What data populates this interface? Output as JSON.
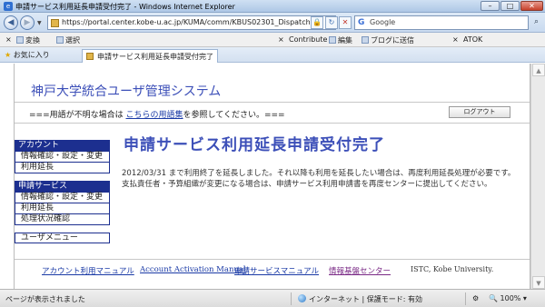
{
  "window": {
    "title": "申請サービス利用延長申請受付完了 - Windows Internet Explorer",
    "min_label": "–",
    "max_label": "□",
    "close_label": "✕"
  },
  "address_bar": {
    "url": "https://portal.center.kobe-u.ac.jp/KUMA/comm/KBUS02301_Dispatch.do",
    "search_placeholder": "Google",
    "search_engine_letter": "G"
  },
  "links_bar": {
    "left_close": "×",
    "convert": "変換",
    "select": "選択",
    "mid_close": "×",
    "contribute": "Contribute",
    "edit": "編集",
    "blog": "ブログに送信",
    "right_close": "×",
    "atok": "ATOK"
  },
  "tabs": {
    "favorites": "お気に入り",
    "active_tab": "申請サービス利用延長申請受付完了"
  },
  "page": {
    "system_title": "神戸大学統合ユーザ管理システム",
    "notice_prefix": "===用語が不明な場合は",
    "notice_link": "こちらの用語集",
    "notice_suffix": "を参照してください。===",
    "logout_label": "ログアウト",
    "main_title": "申請サービス利用延長申請受付完了",
    "message_line1": "2012/03/31 まで利用終了を延長しました。それ以降も利用を延長したい場合は、再度利用延長処理が必要です。",
    "message_line2": "支払責任者・予算組織が変更になる場合は、申請サービス利用申請書を再度センターに提出してください。"
  },
  "sidebar": {
    "account_header": "アカウント",
    "account_items": [
      "情報確認・設定・変更",
      "利用延長"
    ],
    "service_header": "申請サービス",
    "service_items": [
      "情報確認・設定・変更",
      "利用延長",
      "処理状況確認"
    ],
    "user_menu": "ユーザメニュー"
  },
  "footer": {
    "link_account_manual": "アカウント利用マニュアル",
    "link_activation_manual": "Account Activation Manual",
    "link_service_manual": "申請サービスマニュアル",
    "link_center": "情報基盤センター",
    "copyright": "ISTC, Kobe University."
  },
  "status_bar": {
    "status_text": "ページが表示されました",
    "zone": "インターネット | 保護モード: 有効",
    "zoom": "100%"
  },
  "colors": {
    "accent_blue": "#3c4fb8",
    "nav_header": "#1c2f8f",
    "link_blue": "#1a3aa6",
    "link_purple": "#7a2a86"
  }
}
